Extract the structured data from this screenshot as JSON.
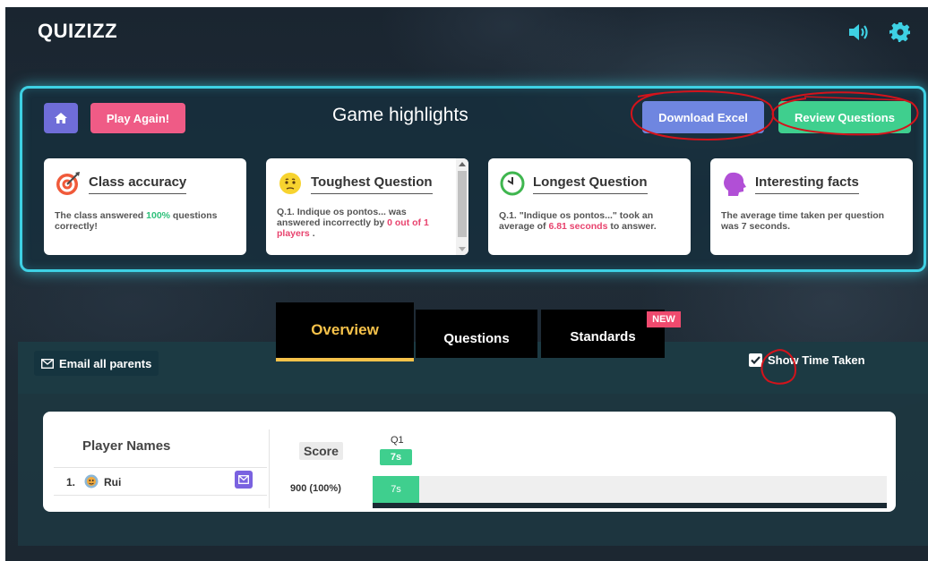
{
  "header": {
    "logo": "QUIZIZZ",
    "icons": [
      "speaker-icon",
      "gear-icon"
    ]
  },
  "highlights": {
    "title": "Game highlights",
    "play_again": "Play Again!",
    "download_excel": "Download Excel",
    "review_questions": "Review Questions",
    "cards": [
      {
        "title": "Class accuracy",
        "icon": "target-icon",
        "text_a": "The class answered ",
        "emph": "100%",
        "text_b": " questions correctly!"
      },
      {
        "title": "Toughest Question",
        "icon": "sweat-face-icon",
        "text_a": "Q.1. Indique os pontos... was answered incorrectly by ",
        "emph": "0 out of 1 players",
        "text_b": " ."
      },
      {
        "title": "Longest Question",
        "icon": "clock-icon",
        "text_a": "Q.1. \"Indique os pontos...\" took an average of ",
        "emph": "6.81 seconds",
        "text_b": " to answer."
      },
      {
        "title": "Interesting facts",
        "icon": "head-icon",
        "text_a": "The average time taken per question was 7 seconds.",
        "emph": "",
        "text_b": ""
      }
    ]
  },
  "tabs": {
    "overview": "Overview",
    "questions": "Questions",
    "standards": "Standards",
    "new_badge": "NEW"
  },
  "toolbar": {
    "email_all_parents": "Email all parents",
    "show_time_taken": "Show Time Taken",
    "show_time_checked": true
  },
  "table": {
    "player_names_header": "Player Names",
    "score_header": "Score",
    "question_label": "Q1",
    "question_time": "7s",
    "rows": [
      {
        "index": "1.",
        "name": "Rui",
        "score": "900 (100%)",
        "time": "7s"
      }
    ]
  },
  "colors": {
    "accent_cyan": "#3ed1e4",
    "play_again": "#ef5b86",
    "download": "#6f86e0",
    "review": "#3fcf8e",
    "tab_active": "#f6c24a",
    "annotation_red": "#d4131b"
  }
}
